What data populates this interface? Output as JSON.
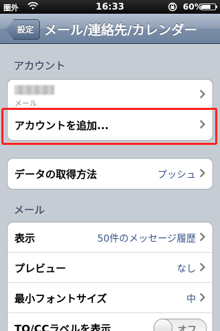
{
  "status_bar": {
    "carrier": "圏外",
    "time": "16:33",
    "battery_pct": "60%",
    "battery_level": 0.6,
    "icons": [
      "wifi-icon",
      "rotation-lock-icon",
      "battery-icon"
    ]
  },
  "nav": {
    "back_label": "設定",
    "title": "メール/連絡先/カレンダー"
  },
  "accounts_section": {
    "header": "アカウント",
    "account_sub": "メール",
    "add_account": "アカウントを追加..."
  },
  "fetch_row": {
    "label": "データの取得方法",
    "value": "プッシュ"
  },
  "mail_section": {
    "header": "メール",
    "rows": [
      {
        "label": "表示",
        "value": "50件のメッセージ履歴"
      },
      {
        "label": "プレビュー",
        "value": "なし"
      },
      {
        "label": "最小フォントサイズ",
        "value": "中"
      },
      {
        "label": "TO/CCラベルを表示",
        "toggle": "オフ"
      }
    ]
  },
  "colors": {
    "highlight": "#ff2020",
    "value_text": "#385487"
  }
}
